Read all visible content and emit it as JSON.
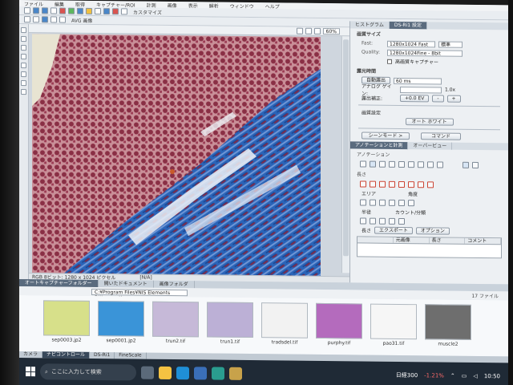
{
  "menu": [
    "ファイル",
    "編集",
    "取得",
    "キャプチャー/ROI",
    "計測",
    "画像",
    "表示",
    "解析",
    "ウィンドウ",
    "ヘルプ"
  ],
  "toolbar": {
    "file_label": "AVG 画像",
    "mode_label": "カスタマイズ",
    "zoom": "60%"
  },
  "image_status": {
    "left": "RGB 8ビット: 1280 x 1024 ピクセル",
    "right": "[N/A]"
  },
  "panel": {
    "tabs": [
      "ヒストグラム",
      "DS-Ri1 設定"
    ],
    "resolution_header": "画質サイズ",
    "fast_label": "Fast:",
    "fast_value": "1280x1024 Fast",
    "fast_option": "標準",
    "quality_label": "Quality:",
    "quality_value": "1280x1024Fine - 8bit",
    "hq_capture": "高画質キャプチャー",
    "exposure_header": "露光時間",
    "auto_exposure": "自動露出",
    "exposure_value": "60 ms",
    "analog_gain": "アナログ ゲイン:",
    "gain_value": "1.0x",
    "exposure_comp": "露出補正:",
    "exposure_comp_value": "+0.0 EV",
    "image_settings": "画質設定",
    "auto_white": "オート ホワイト",
    "scene_mode": "シーンモード >",
    "command": "コマンド"
  },
  "annotation": {
    "tabs": [
      "アノテーションと計測",
      "オーバービュー"
    ],
    "section_annotation": "アノテーション",
    "section_length": "長さ",
    "section_area": "エリア",
    "section_angle": "角度",
    "section_radius": "半径",
    "section_count": "カウント/分類",
    "section_other": "その他",
    "bottom_length": "長さ",
    "export": "エクスポート",
    "option": "オプション",
    "table_headers": [
      "",
      "元画像",
      "長さ",
      "コメント"
    ]
  },
  "bottom_tabs": [
    "オートキャプチャーフォルダー",
    "開いたドキュメント",
    "画像フォルダ"
  ],
  "path": "C:¥Program Files¥NIS Elements D¥Images¥",
  "file_count": "17 ファイル",
  "thumbnails": [
    {
      "name": "sep0003.jp2",
      "color": "#d7e08a"
    },
    {
      "name": "sep0001.jp2",
      "color": "#3a94d8"
    },
    {
      "name": "trun2.tif",
      "color": "#c6b9d8"
    },
    {
      "name": "trun1.tif",
      "color": "#bcb0d6"
    },
    {
      "name": "tradsdel.tif",
      "color": "#f2f2f2"
    },
    {
      "name": "purphy.tif",
      "color": "#b46bbd"
    },
    {
      "name": "pao31.tif",
      "color": "#f6f6f6"
    },
    {
      "name": "muscle2",
      "color": "#6e6e6e"
    }
  ],
  "app_tabs": [
    "カメラ",
    "ナビコントロール",
    "DS-Ri1",
    "FineScale"
  ],
  "taskbar": {
    "search_placeholder": "ここに入力して検索",
    "stock_name": "日経300",
    "stock_change": "-1.21%",
    "time": "10:50"
  }
}
